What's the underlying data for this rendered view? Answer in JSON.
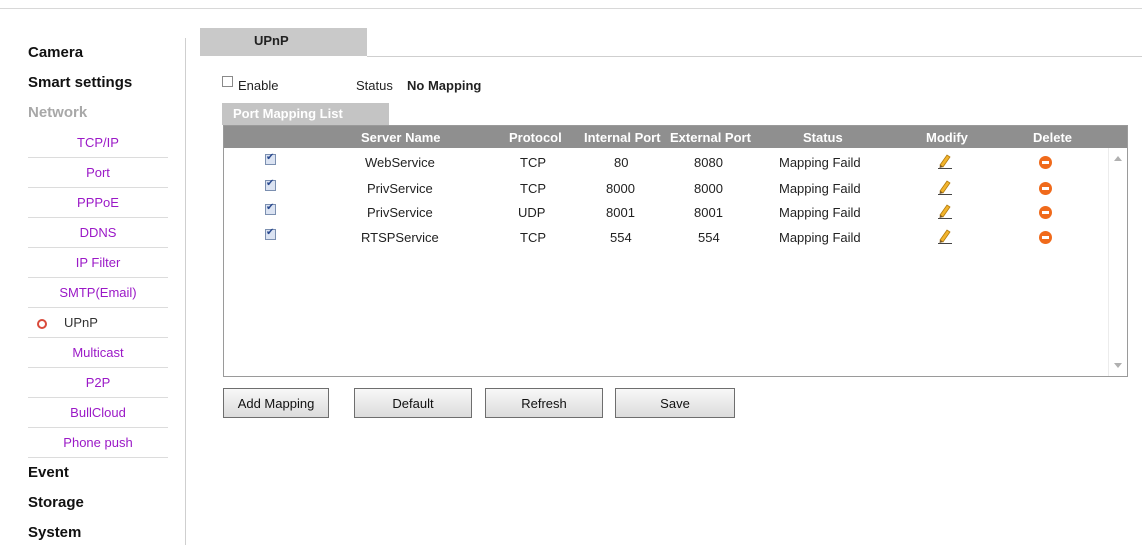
{
  "sidebar": {
    "categories_top": [
      {
        "label": "Camera"
      },
      {
        "label": "Smart settings"
      },
      {
        "label": "Network"
      }
    ],
    "network_items": [
      {
        "label": "TCP/IP"
      },
      {
        "label": "Port"
      },
      {
        "label": "PPPoE"
      },
      {
        "label": "DDNS"
      },
      {
        "label": "IP Filter"
      },
      {
        "label": "SMTP(Email)"
      },
      {
        "label": "UPnP",
        "active": true
      },
      {
        "label": "Multicast"
      },
      {
        "label": "P2P"
      },
      {
        "label": "BullCloud"
      },
      {
        "label": "Phone push"
      }
    ],
    "categories_bottom": [
      {
        "label": "Event"
      },
      {
        "label": "Storage"
      },
      {
        "label": "System"
      }
    ]
  },
  "page": {
    "tab_title": "UPnP",
    "enable_label": "Enable",
    "enable_checked": false,
    "status_label": "Status",
    "status_value": "No Mapping",
    "list_title": "Port Mapping List"
  },
  "table": {
    "headers": {
      "server_name": "Server Name",
      "protocol": "Protocol",
      "internal_port": "Internal Port",
      "external_port": "External Port",
      "status": "Status",
      "modify": "Modify",
      "delete": "Delete"
    },
    "rows": [
      {
        "checked": true,
        "server_name": "WebService",
        "protocol": "TCP",
        "internal_port": "80",
        "external_port": "8080",
        "status": "Mapping Faild"
      },
      {
        "checked": true,
        "server_name": "PrivService",
        "protocol": "TCP",
        "internal_port": "8000",
        "external_port": "8000",
        "status": "Mapping Faild"
      },
      {
        "checked": true,
        "server_name": "PrivService",
        "protocol": "UDP",
        "internal_port": "8001",
        "external_port": "8001",
        "status": "Mapping Faild"
      },
      {
        "checked": true,
        "server_name": "RTSPService",
        "protocol": "TCP",
        "internal_port": "554",
        "external_port": "554",
        "status": "Mapping Faild"
      }
    ]
  },
  "buttons": {
    "add_mapping": "Add Mapping",
    "default": "Default",
    "refresh": "Refresh",
    "save": "Save"
  },
  "colors": {
    "nav_link": "#9b19c7",
    "table_header_bg": "#8f8f8f",
    "delete_icon": "#f06a1b",
    "active_marker": "#d94a3b"
  }
}
